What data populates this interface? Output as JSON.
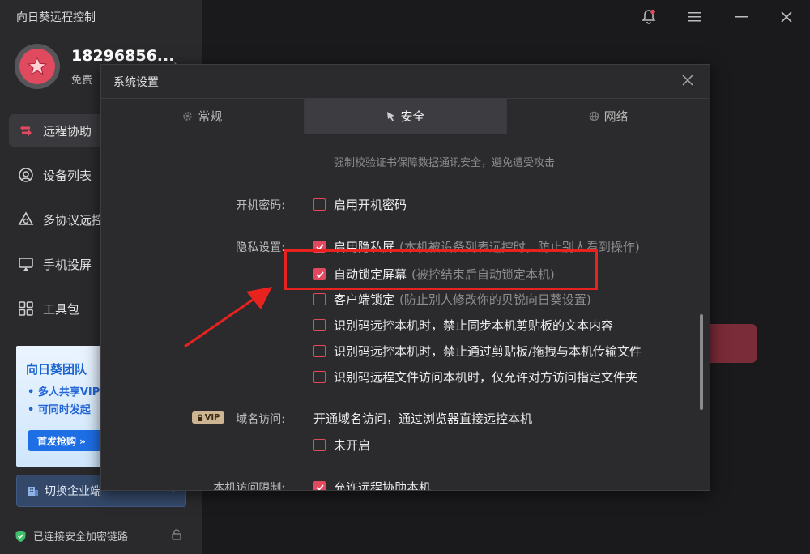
{
  "app": {
    "title": "向日葵远程控制"
  },
  "user": {
    "id": "18296856...",
    "plan": "免费"
  },
  "nav": {
    "items": [
      {
        "label": "远程协助",
        "icon": "remote-assist-icon"
      },
      {
        "label": "设备列表",
        "icon": "device-list-icon"
      },
      {
        "label": "多协议远控",
        "icon": "multi-protocol-icon"
      },
      {
        "label": "手机投屏",
        "icon": "screen-cast-icon"
      },
      {
        "label": "工具包",
        "icon": "toolkit-icon"
      }
    ]
  },
  "promo": {
    "title": "向日葵团队",
    "line1": "• 多人共享VIP",
    "line2": "• 可同时发起",
    "button": "首发抢购 »"
  },
  "enterprise": {
    "label": "切换企业端"
  },
  "status": {
    "text": "已连接安全加密链路"
  },
  "dialog": {
    "title": "系统设置",
    "tabs": [
      {
        "label": "常规",
        "icon": "gear-icon"
      },
      {
        "label": "安全",
        "icon": "cursor-icon"
      },
      {
        "label": "网络",
        "icon": "globe-icon"
      }
    ],
    "active_tab": "安全",
    "faded_text": "强制校验证书保障数据通讯安全，避免遭受攻击",
    "boot_password": {
      "label": "开机密码:",
      "option": {
        "text": "启用开机密码",
        "checked": false
      }
    },
    "privacy": {
      "label": "隐私设置:",
      "options": [
        {
          "text": "启用隐私屏",
          "hint": "(本机被设备列表远控时，防止别人看到操作)",
          "checked": true
        },
        {
          "text": "自动锁定屏幕",
          "hint": "(被控结束后自动锁定本机)",
          "checked": true
        },
        {
          "text": "客户端锁定",
          "hint": "(防止别人修改你的贝锐向日葵设置)",
          "checked": false
        },
        {
          "text": "识别码远控本机时，禁止同步本机剪贴板的文本内容",
          "hint": "",
          "checked": false
        },
        {
          "text": "识别码远控本机时，禁止通过剪贴板/拖拽与本机传输文件",
          "hint": "",
          "checked": false
        },
        {
          "text": "识别码远程文件访问本机时，仅允许对方访问指定文件夹",
          "hint": "",
          "checked": false
        }
      ]
    },
    "domain_access": {
      "vip": "VIP",
      "label": "域名访问:",
      "description": "开通域名访问，通过浏览器直接远控本机",
      "option": {
        "text": "未开启",
        "checked": false
      }
    },
    "local_access": {
      "label": "本机访问限制:",
      "option": {
        "text": "允许远程协助本机",
        "checked": true
      }
    }
  },
  "colors": {
    "accent": "#e0495e",
    "highlight": "#e8231f",
    "enterprise": "#34496a"
  }
}
